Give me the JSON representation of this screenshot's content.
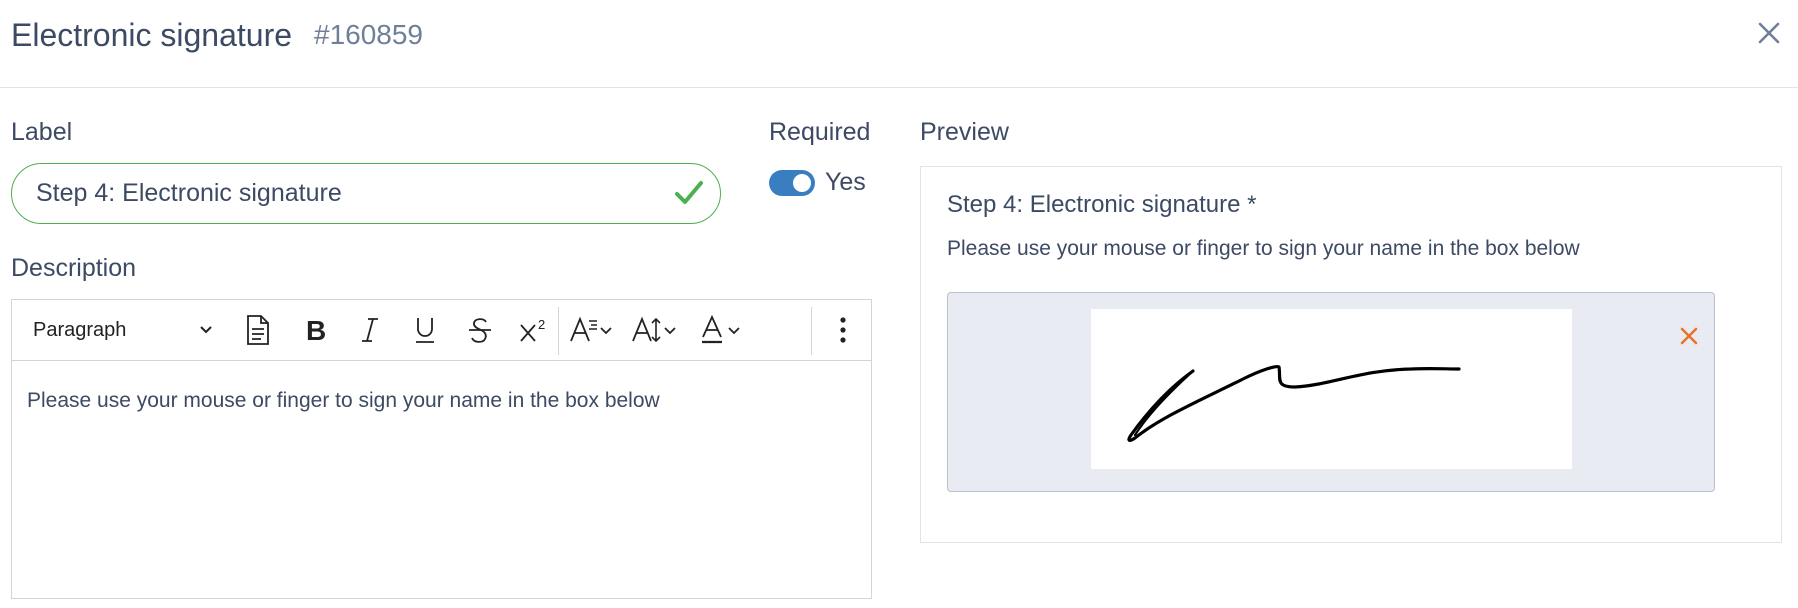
{
  "header": {
    "title": "Electronic signature",
    "ticket_id": "#160859"
  },
  "form": {
    "label_heading": "Label",
    "label_value": "Step 4: Electronic signature",
    "required_heading": "Required",
    "required_on": true,
    "required_text": "Yes",
    "description_heading": "Description"
  },
  "editor": {
    "block_format": "Paragraph",
    "content": "Please use your mouse or finger to sign your name in the box below"
  },
  "preview": {
    "heading": "Preview",
    "title": "Step 4: Electronic signature *",
    "description": "Please use your mouse or finger to sign your name in the box below"
  },
  "icons": {
    "close": "close-icon",
    "valid": "check-icon",
    "clear_signature": "close-icon",
    "accent_color": "#3a7ec2",
    "valid_color": "#4caf50",
    "clear_color": "#e8742a"
  }
}
